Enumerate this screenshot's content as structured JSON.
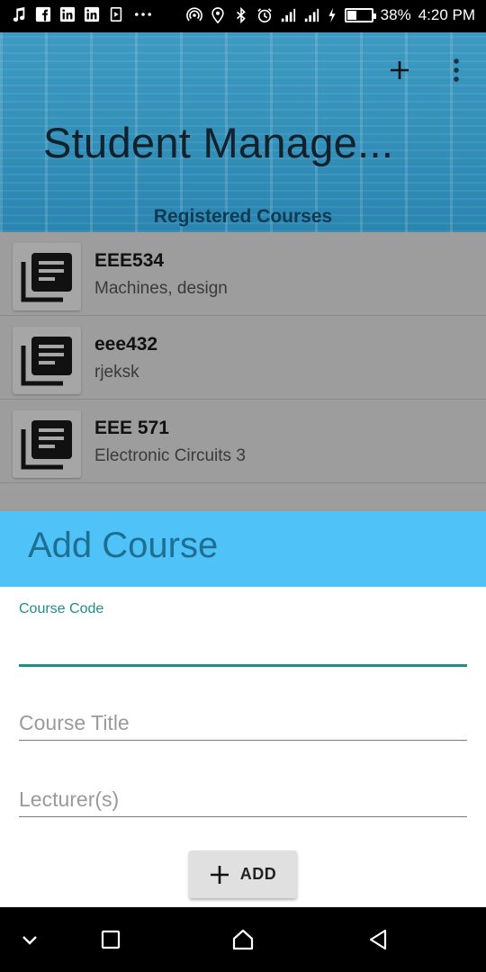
{
  "status_bar": {
    "battery": "38%",
    "battery_level": 0.38,
    "time": "4:20 PM",
    "left_icons": [
      "music-icon",
      "facebook-icon",
      "linkedin-icon",
      "linkedin-icon",
      "notification-icon",
      "more-notifications-icon"
    ],
    "right_icons": [
      "hotspot-icon",
      "location-icon",
      "bluetooth-icon",
      "alarm-icon",
      "signal-icon",
      "signal-4g-icon",
      "charging-icon"
    ]
  },
  "app_bar": {
    "title": "Student Manage...",
    "subtitle": "Registered Courses",
    "actions": [
      "add-icon",
      "more-vert-icon"
    ]
  },
  "courses": [
    {
      "code": "EEE534",
      "title": "Machines, design"
    },
    {
      "code": "eee432",
      "title": "rjeksk"
    },
    {
      "code": "EEE 571",
      "title": "Electronic Circuits 3"
    }
  ],
  "dialog": {
    "title": "Add Course",
    "fields": {
      "course_code": {
        "label": "Course Code",
        "value": ""
      },
      "course_title": {
        "placeholder": "Course Title",
        "value": ""
      },
      "lecturers": {
        "placeholder": "Lecturer(s)",
        "value": ""
      }
    },
    "add_button_label": "ADD"
  },
  "colors": {
    "header": "#2f8cb6",
    "dialog_header": "#4fc3f7",
    "dialog_title": "#1f6f93",
    "accent": "#1e8f86",
    "list_dim": "#9d9d9d"
  },
  "nav_bar": [
    "chevron-down-icon",
    "recents-icon",
    "home-icon",
    "back-icon"
  ]
}
